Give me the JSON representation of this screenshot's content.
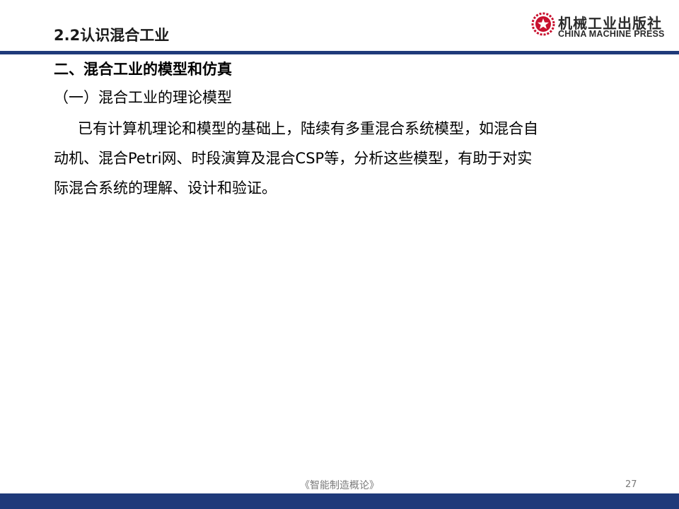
{
  "header": {
    "title": "2.2认识混合工业",
    "logo": {
      "name_cn": "机械工业出版社",
      "name_en": "CHINA MACHINE PRESS",
      "emblem_icon": "star-gear-emblem-icon",
      "emblem_color": "#c8102e"
    },
    "rule_color": "#1f3a7a"
  },
  "content": {
    "section_heading": "二、混合工业的模型和仿真",
    "subsection_heading": "（一）混合工业的理论模型",
    "paragraph_lines": [
      "已有计算机理论和模型的基础上，陆续有多重混合系统模型，如混合自",
      "动机、混合Petri网、时段演算及混合CSP等，分析这些模型，有助于对实",
      "际混合系统的理解、设计和验证。"
    ]
  },
  "footer": {
    "book_title": "《智能制造概论》",
    "page_number": "27",
    "bar_color": "#1f3a7a"
  }
}
